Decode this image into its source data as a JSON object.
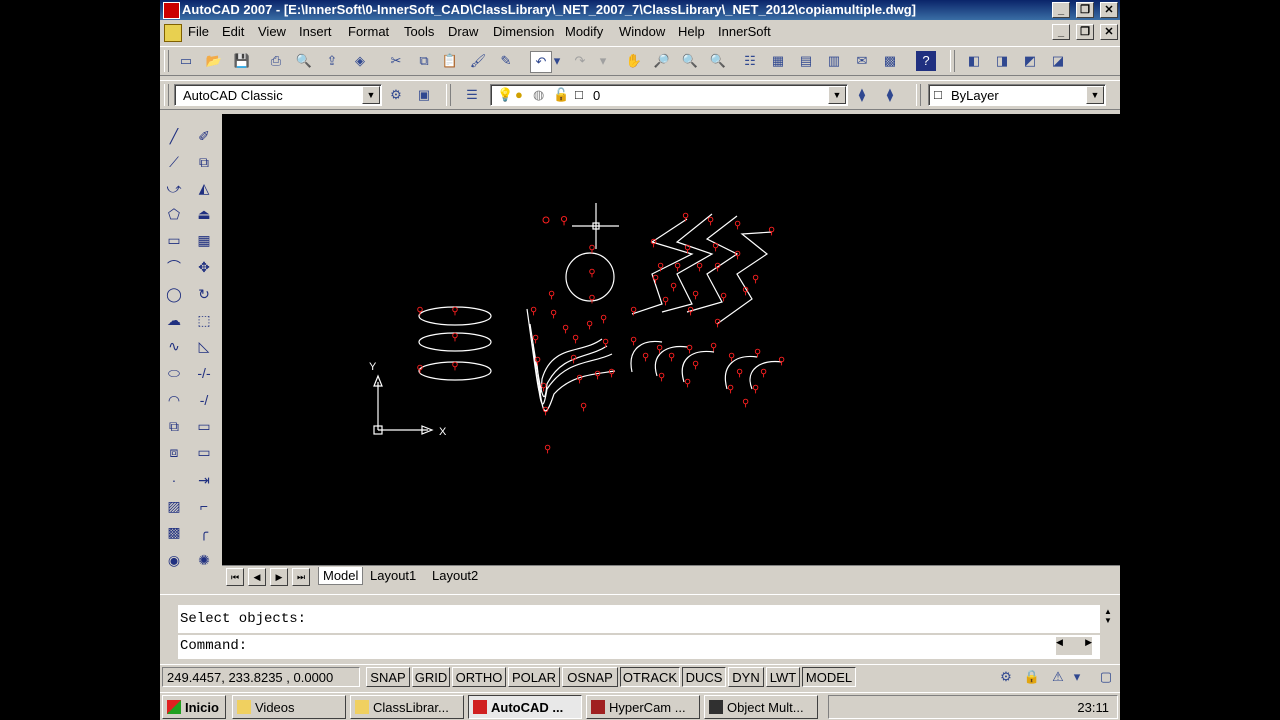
{
  "window": {
    "title": "AutoCAD 2007 - [E:\\InnerSoft\\0-InnerSoft_CAD\\ClassLibrary\\_NET_2007_7\\ClassLibrary\\_NET_2012\\copiamultiple.dwg]"
  },
  "menu": [
    "File",
    "Edit",
    "View",
    "Insert",
    "Format",
    "Tools",
    "Draw",
    "Dimension",
    "Modify",
    "Window",
    "Help",
    "InnerSoft"
  ],
  "toolbar2": {
    "workspace": "AutoCAD Classic",
    "layer": "0",
    "color": "ByLayer"
  },
  "canvas": {
    "ucs_x_label": "X",
    "ucs_y_label": "Y"
  },
  "layout_tabs": [
    "Model",
    "Layout1",
    "Layout2"
  ],
  "command": {
    "history": "Select objects:",
    "prompt": "Command:"
  },
  "status": {
    "coords": "249.4457, 233.8235 , 0.0000",
    "buttons": [
      "SNAP",
      "GRID",
      "ORTHO",
      "POLAR",
      "OSNAP",
      "OTRACK",
      "DUCS",
      "DYN",
      "LWT",
      "MODEL"
    ],
    "active": [
      "OTRACK",
      "DUCS",
      "MODEL"
    ]
  },
  "taskbar": {
    "start": "Inicio",
    "items": [
      "Videos",
      "ClassLibrar...",
      "AutoCAD ...",
      "HyperCam ...",
      "Object Mult..."
    ],
    "clock": "23:11"
  },
  "colors": {
    "canvas": "#000000",
    "entities": "#ffffff",
    "grips": "#ff2020",
    "titlebar": "#0a246a"
  }
}
